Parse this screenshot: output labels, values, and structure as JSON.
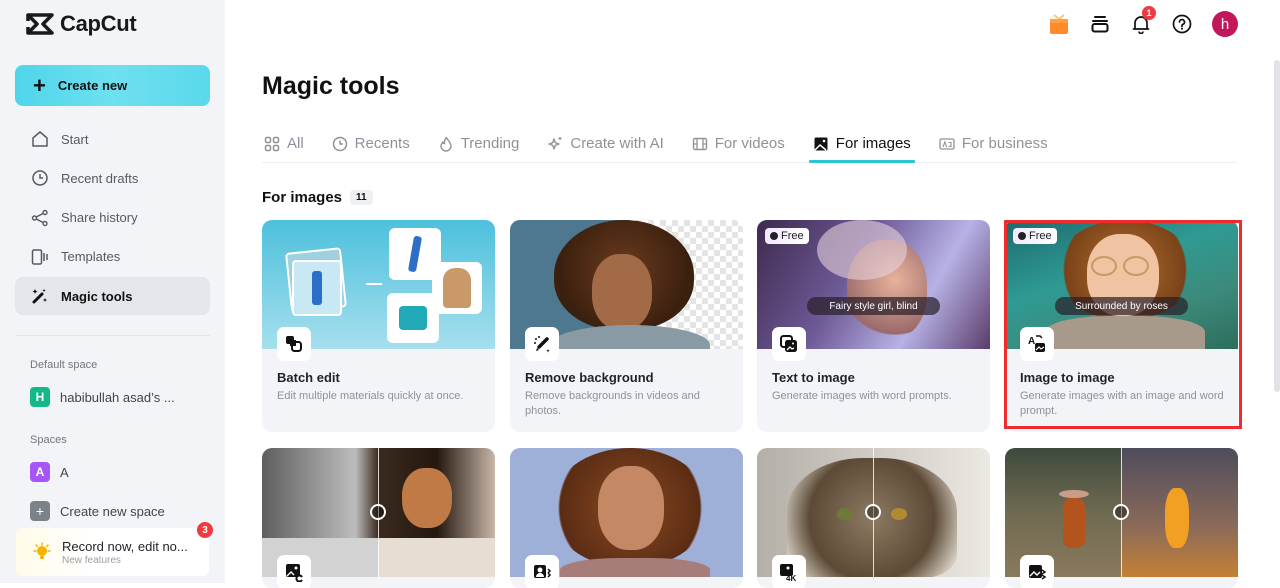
{
  "app": {
    "name": "CapCut"
  },
  "sidebar": {
    "create_label": "Create new",
    "items": [
      {
        "label": "Start",
        "icon": "home-icon"
      },
      {
        "label": "Recent drafts",
        "icon": "clock-icon"
      },
      {
        "label": "Share history",
        "icon": "share-icon"
      },
      {
        "label": "Templates",
        "icon": "templates-icon"
      },
      {
        "label": "Magic tools",
        "icon": "magic-wand-icon",
        "active": true
      }
    ],
    "default_space_label": "Default space",
    "default_space": {
      "initial": "H",
      "name": "habibullah asad’s ...",
      "color": "#12b886"
    },
    "spaces_label": "Spaces",
    "spaces": [
      {
        "initial": "A",
        "name": "A",
        "color": "#a855f7"
      }
    ],
    "create_space_label": "Create new space",
    "promo": {
      "title": "Record now, edit no...",
      "subtitle": "New features",
      "badge": "3"
    }
  },
  "topbar": {
    "notification_count": "1",
    "avatar_initial": "h",
    "avatar_color": "#c2185b"
  },
  "main": {
    "title": "Magic tools",
    "tabs": [
      {
        "label": "All",
        "icon": "grid-icon"
      },
      {
        "label": "Recents",
        "icon": "clock-icon"
      },
      {
        "label": "Trending",
        "icon": "flame-icon"
      },
      {
        "label": "Create with AI",
        "icon": "sparkle-icon"
      },
      {
        "label": "For videos",
        "icon": "film-icon"
      },
      {
        "label": "For images",
        "icon": "image-icon",
        "active": true
      },
      {
        "label": "For business",
        "icon": "ad-icon"
      }
    ],
    "section": {
      "title": "For images",
      "count": "11"
    },
    "cards": [
      {
        "name": "Batch edit",
        "desc": "Edit multiple materials quickly at once.",
        "icon": "batch-edit-icon"
      },
      {
        "name": "Remove background",
        "desc": "Remove backgrounds in videos and photos.",
        "icon": "remove-bg-icon"
      },
      {
        "name": "Text to image",
        "desc": "Generate images with word prompts.",
        "icon": "text-to-image-icon",
        "badge": "Free",
        "caption": "Fairy style girl, blind"
      },
      {
        "name": "Image to image",
        "desc": "Generate images with an image and word prompt.",
        "icon": "image-to-image-icon",
        "badge": "Free",
        "caption": "Surrounded by roses",
        "highlighted": true
      },
      {
        "name": "",
        "desc": "",
        "icon": "colorize-icon"
      },
      {
        "name": "",
        "desc": "",
        "icon": "portrait-icon"
      },
      {
        "name": "",
        "desc": "",
        "icon": "upscale-4k-icon"
      },
      {
        "name": "",
        "desc": "",
        "icon": "style-transfer-icon"
      }
    ]
  },
  "colors": {
    "accent": "#2bc3d6",
    "highlight_border": "#ef2b2f",
    "badge_red": "#ef3a3f"
  }
}
